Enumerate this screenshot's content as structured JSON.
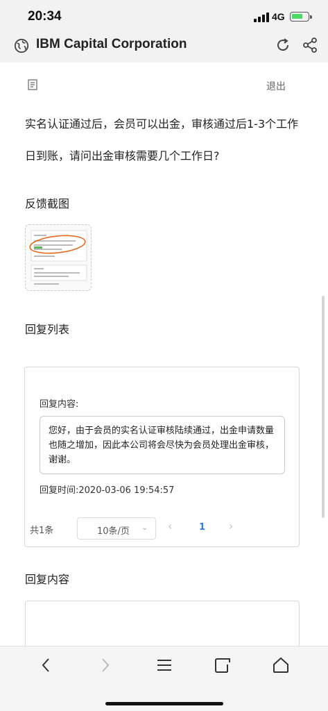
{
  "status_bar": {
    "time": "20:34",
    "network": "4G"
  },
  "browser": {
    "title": "IBM Capital Corporation"
  },
  "header": {
    "logout_label": "退出"
  },
  "question": {
    "line1": "实名认证通过后，会员可以出金，审核通过后1-3个工作",
    "line2": "日到账，请问出金审核需要几个工作日?"
  },
  "screenshot_section": {
    "label": "反馈截图"
  },
  "reply_list": {
    "label": "回复列表",
    "items": [
      {
        "content_label": "回复内容:",
        "content": "您好，由于会员的实名认证审核陆续通过，出金申请数量也随之增加，因此本公司将会尽快为会员处理出金审核，谢谢。",
        "time_label": "回复时间:2020-03-06 19:54:57"
      }
    ],
    "pager": {
      "total": "共1条",
      "page_size": "10条/页",
      "current_page": "1"
    }
  },
  "reply_input": {
    "label": "回复内容"
  },
  "colors": {
    "accent": "#2f7de1",
    "bar_bg": "#f2f2f2"
  }
}
